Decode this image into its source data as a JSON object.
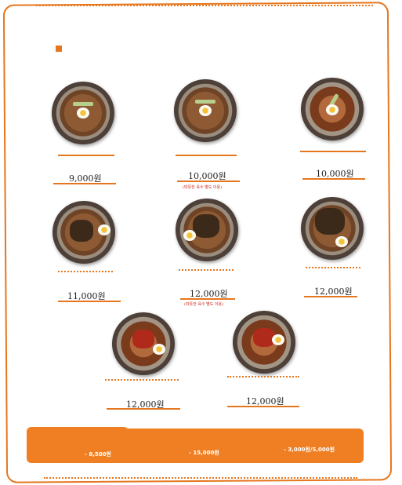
{
  "menu": {
    "items": [
      {
        "price": "9,000원",
        "note": ""
      },
      {
        "price": "10,000원",
        "note": "(따뜻한 육수 별도 이용)"
      },
      {
        "price": "10,000원",
        "note": ""
      },
      {
        "price": "11,000원",
        "note": ""
      },
      {
        "price": "12,000원",
        "note": "(따뜻한 육수 별도 이용)"
      },
      {
        "price": "12,000원",
        "note": ""
      },
      {
        "price": "12,000원",
        "note": ""
      },
      {
        "price": "12,000원",
        "note": ""
      }
    ]
  },
  "banner": {
    "left": "- 8,500원",
    "center": "- 15,000원",
    "right": "- 3,000원/5,000원"
  },
  "colors": {
    "accent": "#e6761e",
    "note": "#d02a1a"
  }
}
